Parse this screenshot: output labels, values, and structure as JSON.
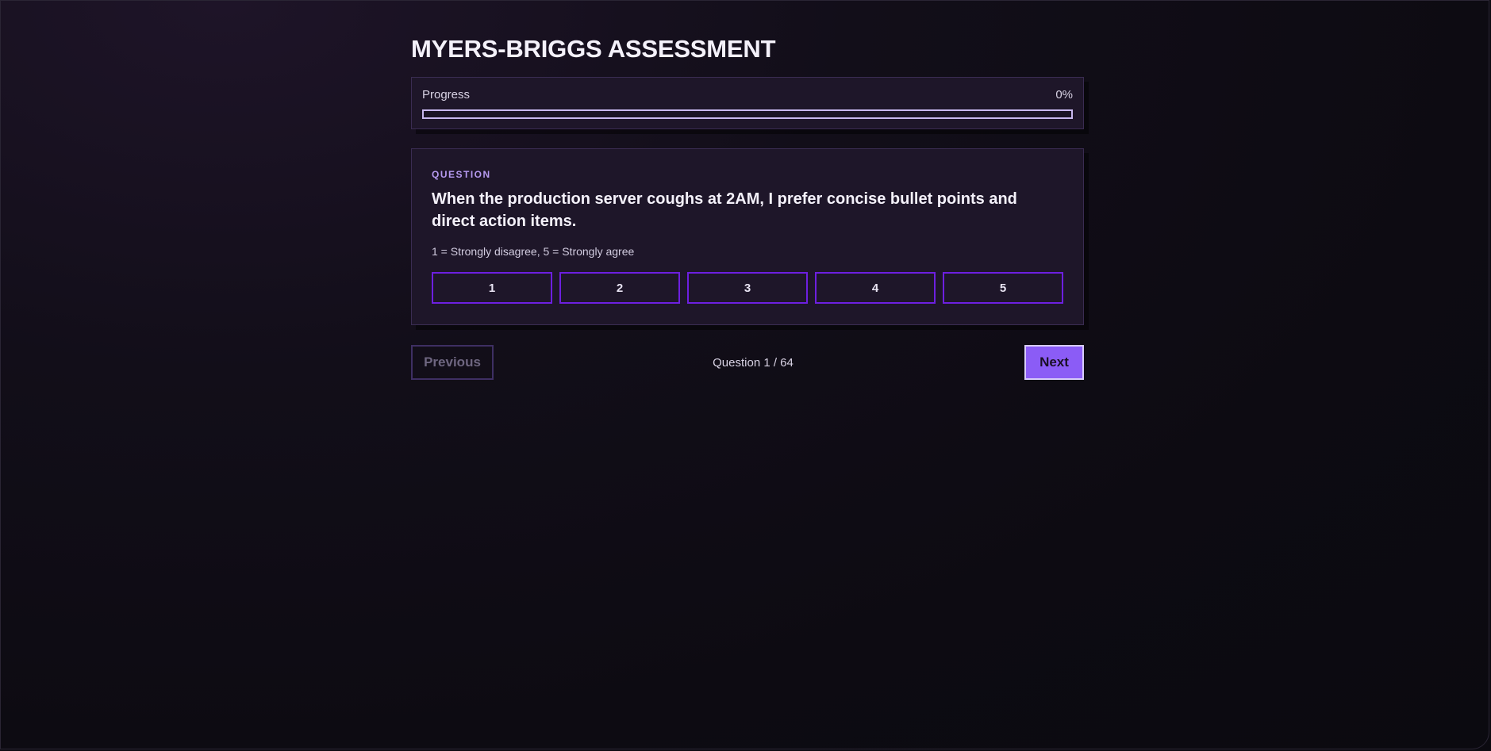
{
  "header": {
    "title": "MYERS-BRIGGS ASSESSMENT"
  },
  "progress": {
    "label": "Progress",
    "percent_label": "0%",
    "value": 0
  },
  "question": {
    "section_label": "QUESTION",
    "text": "When the production server coughs at 2AM, I prefer concise bullet points and direct action items.",
    "scale_hint": "1 = Strongly disagree, 5 = Strongly agree",
    "options": [
      "1",
      "2",
      "3",
      "4",
      "5"
    ]
  },
  "navigation": {
    "previous_label": "Previous",
    "counter": "Question 1 / 64",
    "next_label": "Next",
    "previous_disabled": true
  },
  "colors": {
    "accent": "#8b5cf6",
    "option_border": "#6d1fe0",
    "card_bg": "#1e1629",
    "label_purple": "#b69af0"
  }
}
